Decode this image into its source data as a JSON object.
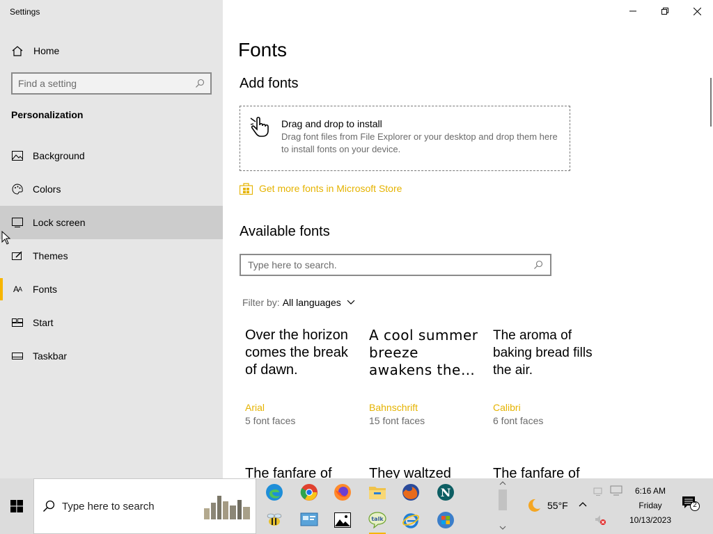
{
  "window": {
    "title": "Settings"
  },
  "sidebar": {
    "home_label": "Home",
    "search_placeholder": "Find a setting",
    "section_title": "Personalization",
    "items": [
      {
        "label": "Background",
        "icon": "picture-icon"
      },
      {
        "label": "Colors",
        "icon": "palette-icon"
      },
      {
        "label": "Lock screen",
        "icon": "lock-screen-icon",
        "hovered": true
      },
      {
        "label": "Themes",
        "icon": "themes-icon"
      },
      {
        "label": "Fonts",
        "icon": "fonts-icon",
        "selected": true
      },
      {
        "label": "Start",
        "icon": "start-icon"
      },
      {
        "label": "Taskbar",
        "icon": "taskbar-icon"
      }
    ]
  },
  "main": {
    "title": "Fonts",
    "add_fonts_heading": "Add fonts",
    "drop_title": "Drag and drop to install",
    "drop_desc": "Drag font files from File Explorer or your desktop and drop them here to install fonts on your device.",
    "store_link": "Get more fonts in Microsoft Store",
    "available_heading": "Available fonts",
    "search_placeholder": "Type here to search.",
    "filter_label": "Filter by:",
    "filter_value": "All languages",
    "fonts": [
      {
        "sample": "Over the horizon comes the break of dawn.",
        "name": "Arial",
        "faces": "5 font faces"
      },
      {
        "sample": "A cool summer breeze awakens the…",
        "name": "Bahnschrift",
        "faces": "15 font faces"
      },
      {
        "sample": "The aroma of baking bread fills the air.",
        "name": "Calibri",
        "faces": "6 font faces"
      }
    ],
    "fonts_row2": [
      {
        "sample": "The fanfare of"
      },
      {
        "sample": "They waltzed"
      },
      {
        "sample": "The fanfare of"
      }
    ]
  },
  "taskbar": {
    "search_placeholder": "Type here to search",
    "weather_temp": "55°F",
    "time": "6:16 AM",
    "day": "Friday",
    "date": "10/13/2023",
    "notification_count": "2",
    "accent": "#f7b500"
  }
}
